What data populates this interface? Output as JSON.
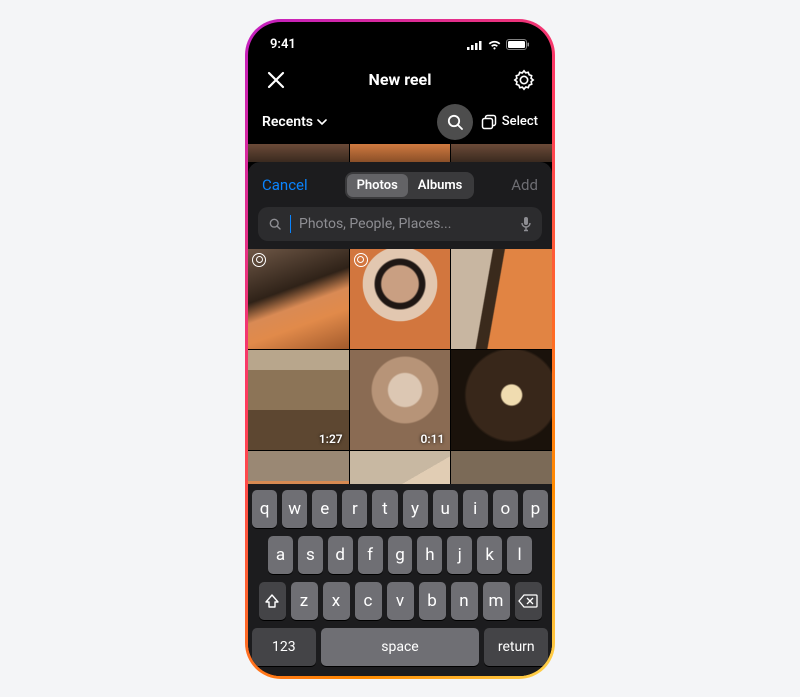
{
  "status": {
    "time": "9:41"
  },
  "header": {
    "title": "New reel"
  },
  "toolbar": {
    "recents_label": "Recents",
    "select_label": "Select"
  },
  "modal": {
    "cancel_label": "Cancel",
    "add_label": "Add",
    "tabs": {
      "photos": "Photos",
      "albums": "Albums"
    },
    "search_placeholder": "Photos, People, Places..."
  },
  "grid": {
    "cells": [
      {
        "live": true,
        "duration": ""
      },
      {
        "live": true,
        "duration": ""
      },
      {
        "live": false,
        "duration": ""
      },
      {
        "live": false,
        "duration": "1:27"
      },
      {
        "live": false,
        "duration": "0:11"
      },
      {
        "live": false,
        "duration": ""
      },
      {
        "live": false,
        "duration": ""
      },
      {
        "live": false,
        "duration": ""
      },
      {
        "live": false,
        "duration": ""
      }
    ]
  },
  "keyboard": {
    "row1": [
      "q",
      "w",
      "e",
      "r",
      "t",
      "y",
      "u",
      "i",
      "o",
      "p"
    ],
    "row2": [
      "a",
      "s",
      "d",
      "f",
      "g",
      "h",
      "j",
      "k",
      "l"
    ],
    "row3": [
      "z",
      "x",
      "c",
      "v",
      "b",
      "n",
      "m"
    ],
    "numbers_label": "123",
    "space_label": "space",
    "return_label": "return"
  }
}
